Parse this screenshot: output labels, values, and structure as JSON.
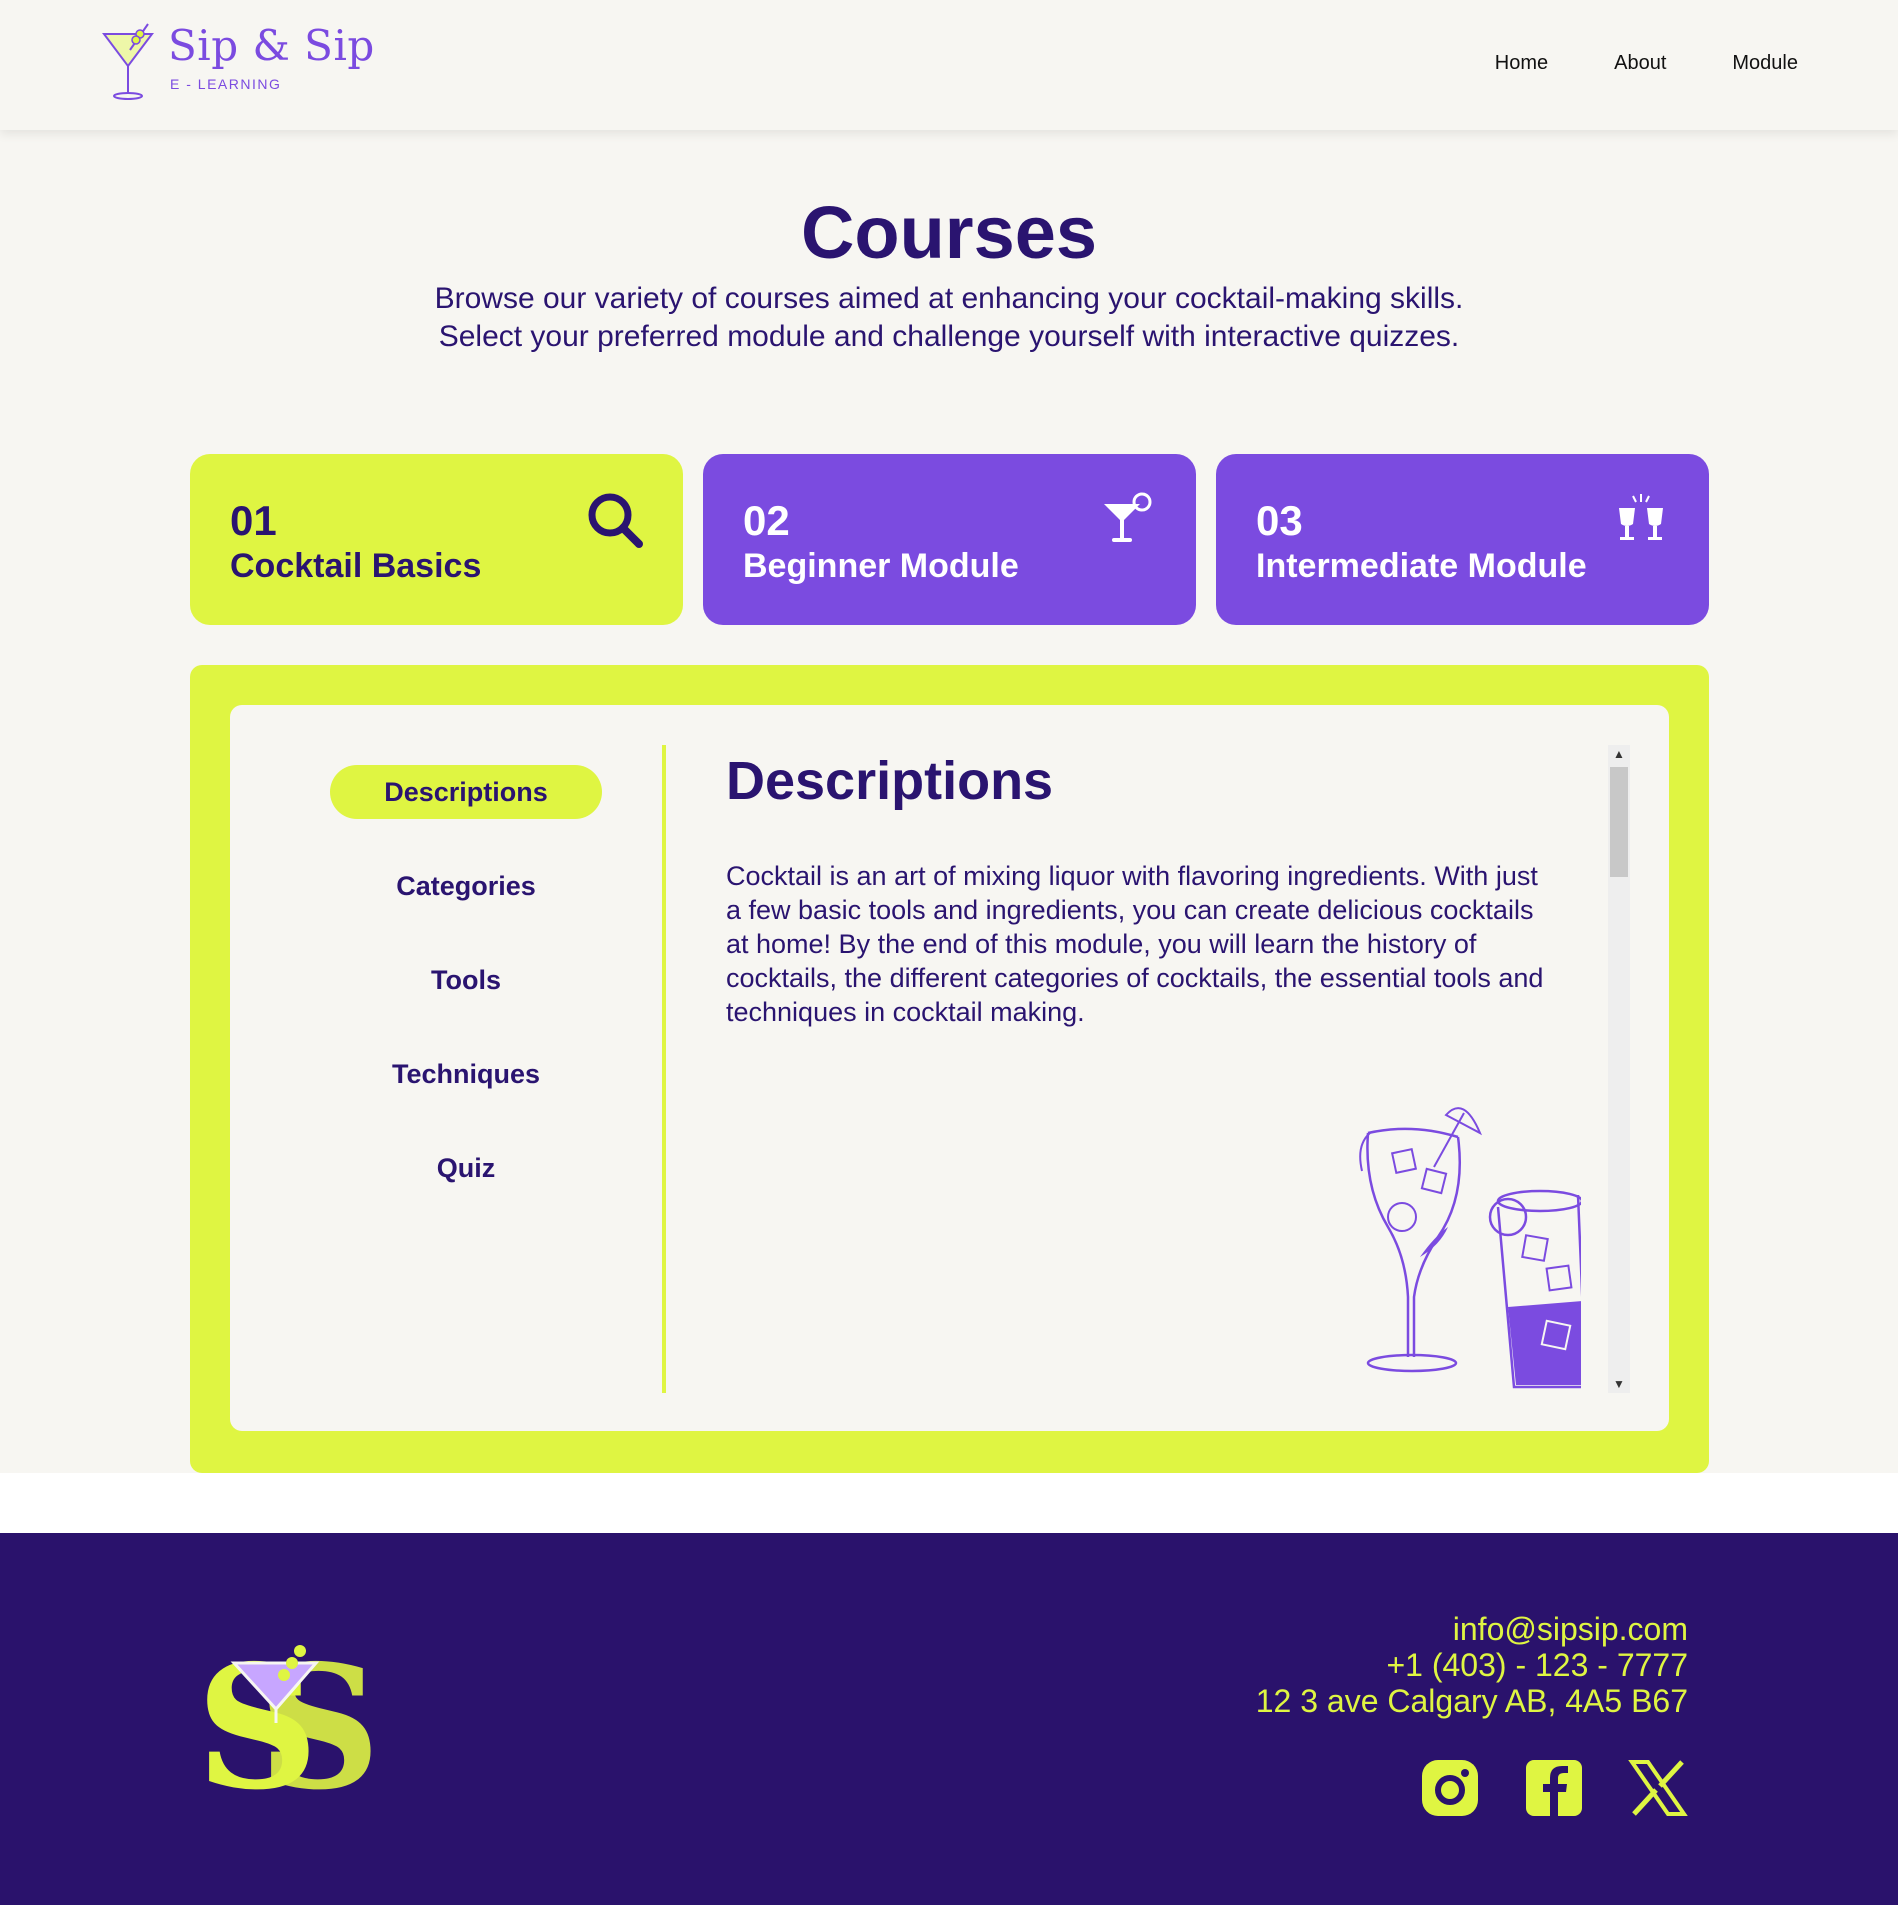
{
  "brand": {
    "name": "Sip & Sip",
    "tagline": "E - LEARNING",
    "accent": "#7b4be0",
    "lime": "#dff542",
    "navy": "#2a1470"
  },
  "nav": {
    "items": [
      {
        "label": "Home"
      },
      {
        "label": "About"
      },
      {
        "label": "Module"
      }
    ]
  },
  "hero": {
    "title": "Courses",
    "desc_line1": "Browse our variety of courses aimed at enhancing your cocktail-making skills.",
    "desc_line2": "Select your preferred module and challenge yourself with interactive quizzes."
  },
  "modules": [
    {
      "num": "01",
      "title": "Cocktail Basics",
      "icon": "search-icon",
      "active": true
    },
    {
      "num": "02",
      "title": "Beginner Module",
      "icon": "cocktail-glass-icon",
      "active": false
    },
    {
      "num": "03",
      "title": "Intermediate Module",
      "icon": "cheers-glasses-icon",
      "active": false
    }
  ],
  "sidebar": {
    "items": [
      {
        "label": "Descriptions",
        "active": true
      },
      {
        "label": "Categories"
      },
      {
        "label": "Tools"
      },
      {
        "label": "Techniques"
      },
      {
        "label": "Quiz"
      }
    ]
  },
  "content": {
    "title": "Descriptions",
    "body": "Cocktail is an art of mixing liquor with flavoring ingredients. With just a few basic tools and ingredients, you can create delicious cocktails at home! By the end of this module, you will learn the history of cocktails, the different categories of cocktails, the essential tools and techniques in cocktail making."
  },
  "footer": {
    "email": "info@sipsip.com",
    "phone": "+1 (403) - 123 - 7777",
    "address": "12 3 ave Calgary AB, 4A5 B67",
    "socials": [
      "instagram-icon",
      "facebook-icon",
      "x-icon"
    ]
  }
}
